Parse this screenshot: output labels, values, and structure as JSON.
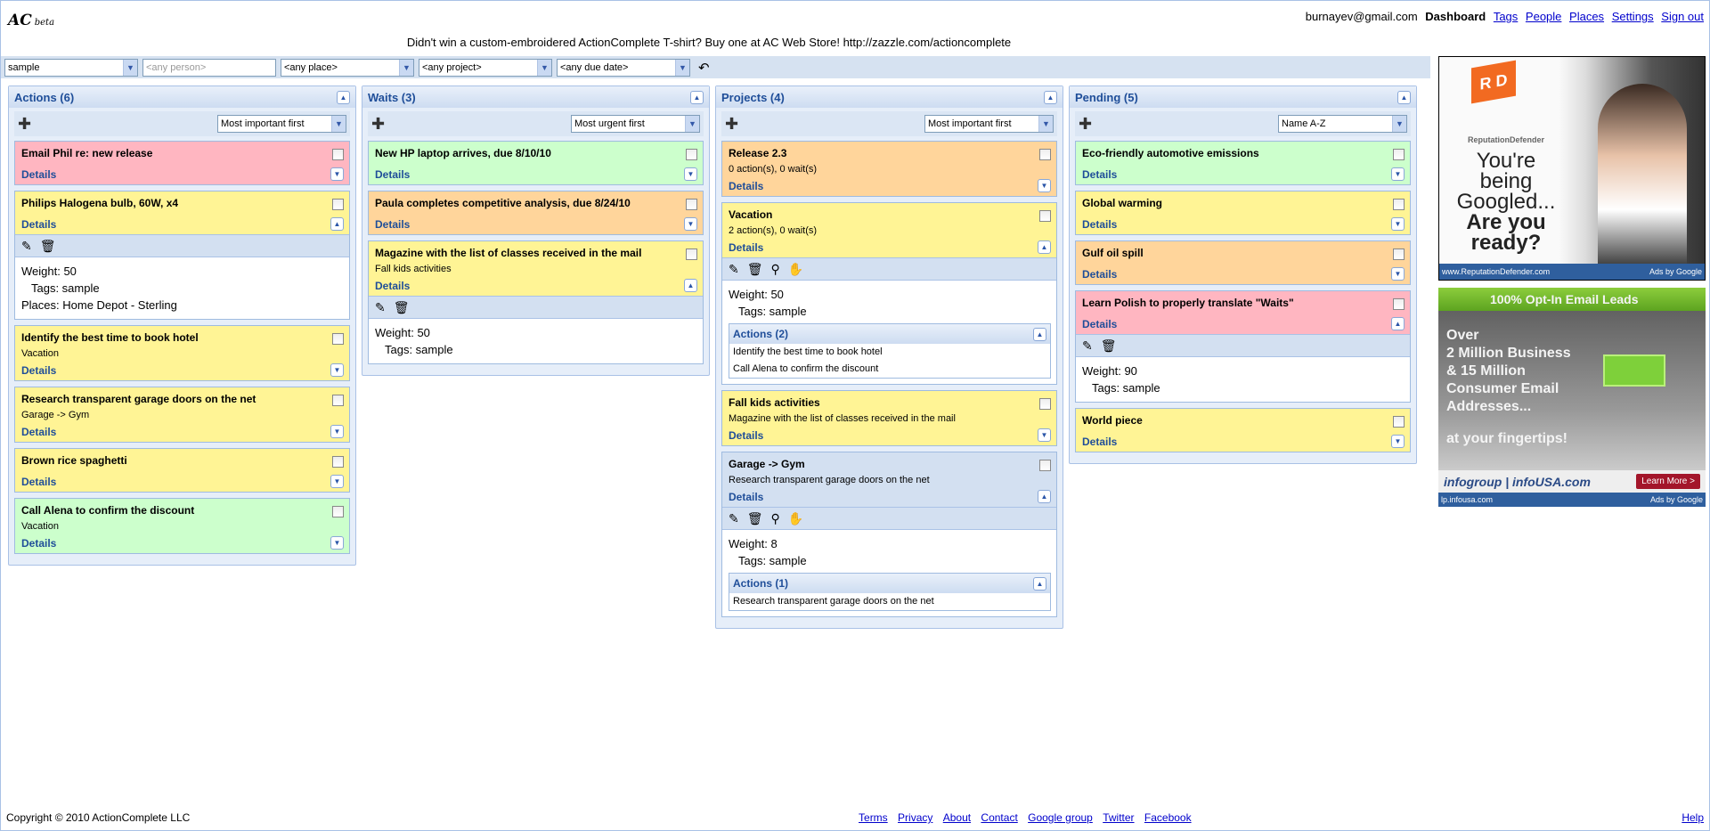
{
  "header": {
    "logo": "AC",
    "logo_tag": "beta",
    "user": "burnayev@gmail.com",
    "nav_current": "Dashboard",
    "nav_links": [
      "Tags",
      "People",
      "Places",
      "Settings",
      "Sign out"
    ],
    "promo": "Didn't win a custom-embroidered ActionComplete T-shirt? Buy one at AC Web Store! http://zazzle.com/actioncomplete"
  },
  "filters": {
    "tag": "sample",
    "person_placeholder": "<any person>",
    "place": "<any place>",
    "project": "<any project>",
    "due": "<any due date>"
  },
  "colors": {
    "pink": "#ffb6c1",
    "yellow": "#fff495",
    "green": "#ccffcc",
    "orange": "#ffd59b",
    "blue": "#d3e0f1"
  },
  "columns": [
    {
      "title": "Actions (6)",
      "sort": "Most important first",
      "cards": [
        {
          "title": "Email Phil re: new release",
          "color": "pink"
        },
        {
          "title": "Philips Halogena bulb, 60W, x4",
          "color": "yellow",
          "expanded": true,
          "tools": [
            "edit",
            "delete"
          ],
          "fields": [
            "Weight: 50",
            "Tags: sample",
            "Places: Home Depot - Sterling"
          ]
        },
        {
          "title": "Identify the best time to book hotel",
          "subtitle": "Vacation",
          "color": "yellow"
        },
        {
          "title": "Research transparent garage doors on the net",
          "subtitle": "Garage -> Gym",
          "color": "yellow"
        },
        {
          "title": "Brown rice spaghetti",
          "subtitle": " ",
          "color": "yellow"
        },
        {
          "title": "Call Alena to confirm the discount",
          "subtitle": "Vacation",
          "color": "green"
        }
      ]
    },
    {
      "title": "Waits (3)",
      "sort": "Most urgent first",
      "cards": [
        {
          "title": "New HP laptop arrives, due 8/10/10",
          "color": "green"
        },
        {
          "title": "Paula completes competitive analysis, due 8/24/10",
          "color": "orange"
        },
        {
          "title": "Magazine with the list of classes received in the mail",
          "subtitle": "Fall kids activities",
          "color": "yellow",
          "expanded": true,
          "tools": [
            "edit",
            "delete"
          ],
          "fields": [
            "Weight: 50",
            "Tags: sample"
          ]
        }
      ]
    },
    {
      "title": "Projects (4)",
      "sort": "Most important first",
      "cards": [
        {
          "title": "Release 2.3",
          "subtitle": "0 action(s), 0 wait(s)",
          "color": "orange"
        },
        {
          "title": "Vacation",
          "subtitle": "2 action(s), 0 wait(s)",
          "color": "yellow",
          "expanded": true,
          "tools": [
            "edit",
            "delete",
            "search",
            "hand"
          ],
          "fields": [
            "Weight: 50",
            "Tags: sample"
          ],
          "sub": {
            "title": "Actions (2)",
            "items": [
              "Identify the best time to book hotel",
              "Call Alena to confirm the discount"
            ]
          }
        },
        {
          "title": "Fall kids activities",
          "subtitle": "Magazine with the list of classes received in the mail",
          "color": "yellow"
        },
        {
          "title": "Garage -> Gym",
          "subtitle": "Research transparent garage doors on the net",
          "color": "blue",
          "expanded": true,
          "tools": [
            "edit",
            "delete",
            "search",
            "hand"
          ],
          "fields": [
            "Weight: 8",
            "Tags: sample"
          ],
          "sub": {
            "title": "Actions (1)",
            "items": [
              "Research transparent garage doors on the net"
            ]
          }
        }
      ]
    },
    {
      "title": "Pending (5)",
      "sort": "Name A-Z",
      "cards": [
        {
          "title": "Eco-friendly automotive emissions",
          "color": "green"
        },
        {
          "title": "Global warming",
          "color": "yellow"
        },
        {
          "title": "Gulf oil spill",
          "color": "orange"
        },
        {
          "title": "Learn Polish to properly translate \"Waits\"",
          "color": "pink",
          "expanded": true,
          "tools": [
            "edit",
            "delete"
          ],
          "fields": [
            "Weight: 90",
            "Tags: sample"
          ]
        },
        {
          "title": "World piece",
          "color": "yellow"
        }
      ]
    }
  ],
  "details_label": "Details",
  "ads": [
    {
      "brand": "ReputationDefender",
      "lines": [
        "You're",
        "being",
        "Googled..."
      ],
      "bold": [
        "Are you",
        "ready?"
      ],
      "url": "www.ReputationDefender.com",
      "by": "Ads by Google"
    },
    {
      "banner": "100% Opt-In Email Leads",
      "lines": [
        "Over",
        "2 Million Business",
        "& 15 Million",
        "Consumer Email",
        "Addresses..."
      ],
      "tail": "at your fingertips!",
      "brand": "infogroup | infoUSA.com",
      "cta": "Learn More >",
      "url": "lp.infousa.com",
      "by": "Ads by Google"
    }
  ],
  "footer": {
    "copyright": "Copyright © 2010 ActionComplete LLC",
    "links": [
      "Terms",
      "Privacy",
      "About",
      "Contact",
      "Google group",
      "Twitter",
      "Facebook"
    ],
    "help": "Help"
  }
}
